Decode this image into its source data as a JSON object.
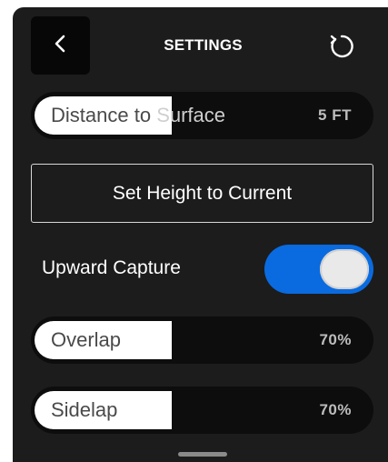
{
  "header": {
    "back_icon": "chevron-left-icon",
    "title": "SETTINGS",
    "reset_icon": "reset-icon"
  },
  "settings": {
    "distance": {
      "label_left": "Distance to",
      "label_right": "Surface",
      "value": "5 FT",
      "fill_fraction": 0.4
    },
    "set_height_label": "Set Height to Current",
    "upward_capture": {
      "label": "Upward Capture",
      "enabled": true
    },
    "overlap": {
      "label": "Overlap",
      "value": "70%",
      "fill_fraction": 0.4
    },
    "sidelap": {
      "label": "Sidelap",
      "value": "70%",
      "fill_fraction": 0.4
    }
  },
  "colors": {
    "background": "#1c1c1c",
    "toggle_on": "#0a6be0",
    "slider_fill": "#ffffff"
  }
}
